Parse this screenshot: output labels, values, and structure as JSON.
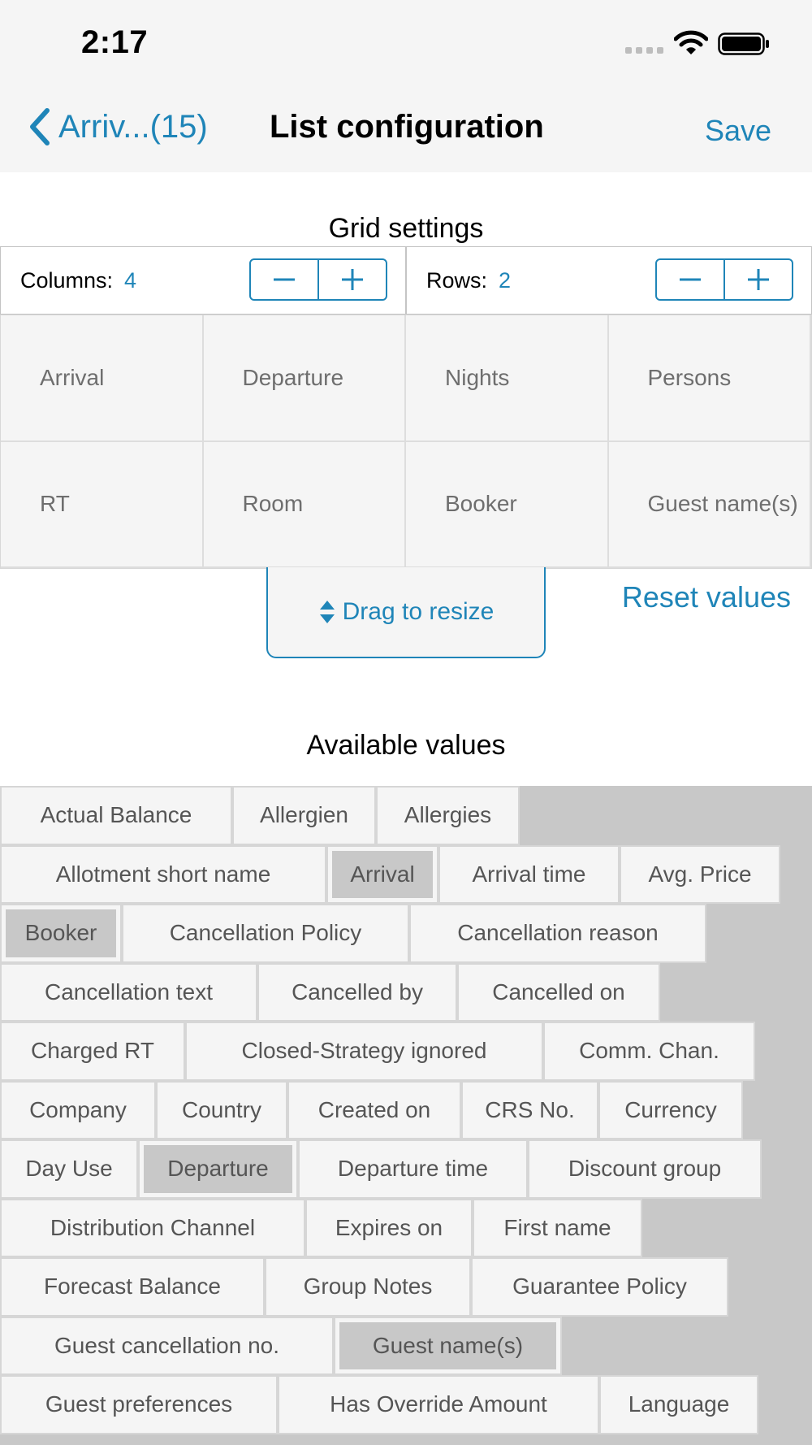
{
  "status_bar": {
    "time": "2:17"
  },
  "nav": {
    "back_label": "Arriv...(15)",
    "title": "List configuration",
    "save_label": "Save"
  },
  "grid_settings": {
    "title": "Grid settings",
    "columns_label": "Columns:",
    "columns_value": "4",
    "rows_label": "Rows:",
    "rows_value": "2"
  },
  "grid_cells": [
    "Arrival",
    "Departure",
    "Nights",
    "Persons",
    "RT",
    "Room",
    "Booker",
    "Guest name(s)"
  ],
  "drag_label": "Drag to resize",
  "reset_label": "Reset values",
  "available": {
    "title": "Available values",
    "rows": [
      [
        {
          "label": "Actual Balance"
        },
        {
          "label": "Allergien"
        },
        {
          "label": "Allergies"
        }
      ],
      [
        {
          "label": "Allotment short name"
        },
        {
          "label": "Arrival",
          "selected": true
        },
        {
          "label": "Arrival time"
        },
        {
          "label": "Avg. Price"
        }
      ],
      [
        {
          "label": "Booker",
          "selected": true
        },
        {
          "label": "Cancellation Policy"
        },
        {
          "label": "Cancellation reason"
        }
      ],
      [
        {
          "label": "Cancellation text"
        },
        {
          "label": "Cancelled by"
        },
        {
          "label": "Cancelled on"
        }
      ],
      [
        {
          "label": "Charged RT"
        },
        {
          "label": "Closed-Strategy ignored"
        },
        {
          "label": "Comm. Chan."
        }
      ],
      [
        {
          "label": "Company"
        },
        {
          "label": "Country"
        },
        {
          "label": "Created on"
        },
        {
          "label": "CRS No."
        },
        {
          "label": "Currency"
        }
      ],
      [
        {
          "label": "Day Use"
        },
        {
          "label": "Departure",
          "selected": true
        },
        {
          "label": "Departure time"
        },
        {
          "label": "Discount group"
        }
      ],
      [
        {
          "label": "Distribution Channel"
        },
        {
          "label": "Expires on"
        },
        {
          "label": "First name"
        }
      ],
      [
        {
          "label": "Forecast Balance"
        },
        {
          "label": "Group Notes"
        },
        {
          "label": "Guarantee Policy"
        }
      ],
      [
        {
          "label": "Guest cancellation no."
        },
        {
          "label": "Guest name(s)",
          "selected": true
        }
      ],
      [
        {
          "label": "Guest preferences"
        },
        {
          "label": "Has Override Amount"
        },
        {
          "label": "Language"
        }
      ]
    ]
  },
  "colors": {
    "accent": "#1f85b8",
    "chip_bg": "#f5f5f5",
    "selected_bg": "#c8c8c8"
  }
}
